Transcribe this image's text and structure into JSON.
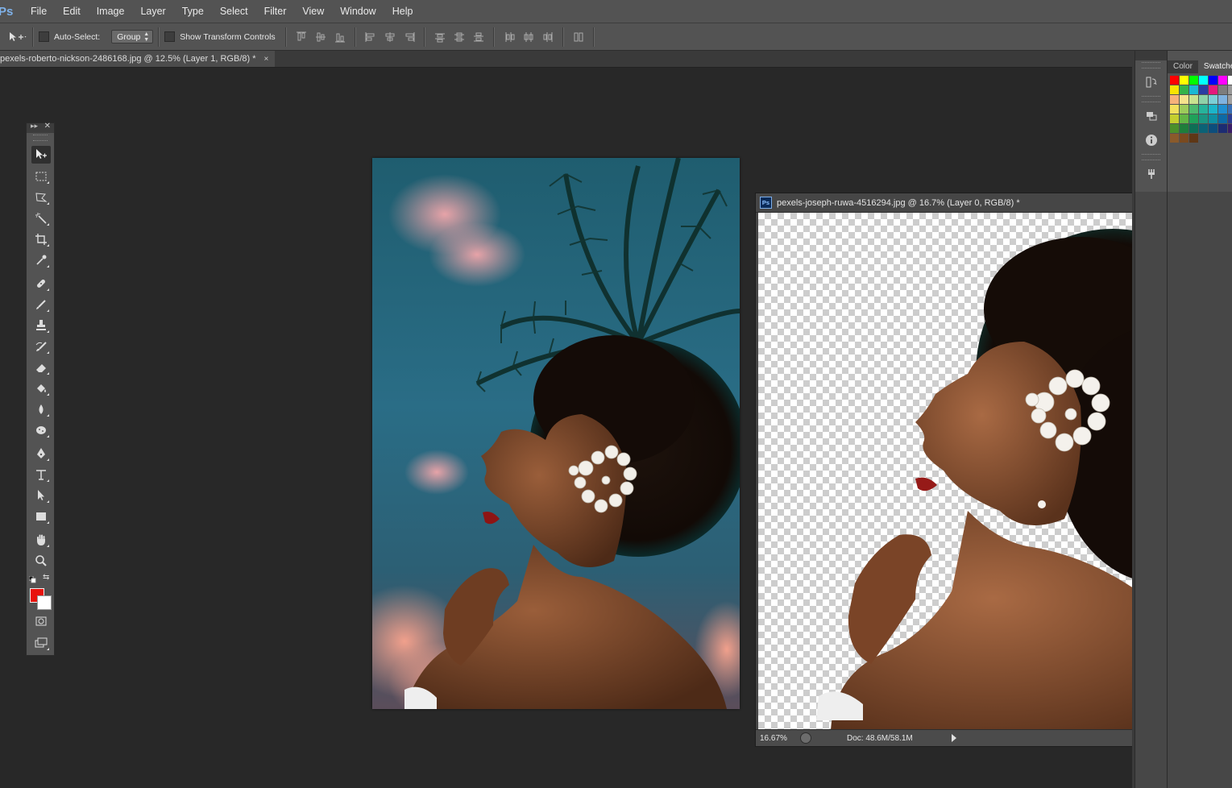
{
  "app": {
    "logo": "Ps",
    "menu": [
      "File",
      "Edit",
      "Image",
      "Layer",
      "Type",
      "Select",
      "Filter",
      "View",
      "Window",
      "Help"
    ]
  },
  "options_bar": {
    "auto_select_label": "Auto-Select:",
    "auto_select_value": "Group",
    "show_transform_label": "Show Transform Controls"
  },
  "document_tab": {
    "title": "pexels-roberto-nickson-2486168.jpg @ 12.5% (Layer 1, RGB/8) *",
    "close": "×"
  },
  "floating_window": {
    "title": "pexels-joseph-ruwa-4516294.jpg @ 16.7% (Layer 0, RGB/8) *",
    "icon_text": "Ps",
    "zoom": "16.67%",
    "doc_info": "Doc: 48.6M/58.1M"
  },
  "toolbox": {
    "foreground_color": "#e8120c",
    "background_color": "#ffffff"
  },
  "panels": {
    "tabs": [
      "Color",
      "Swatches"
    ],
    "active_tab": "Swatches"
  }
}
